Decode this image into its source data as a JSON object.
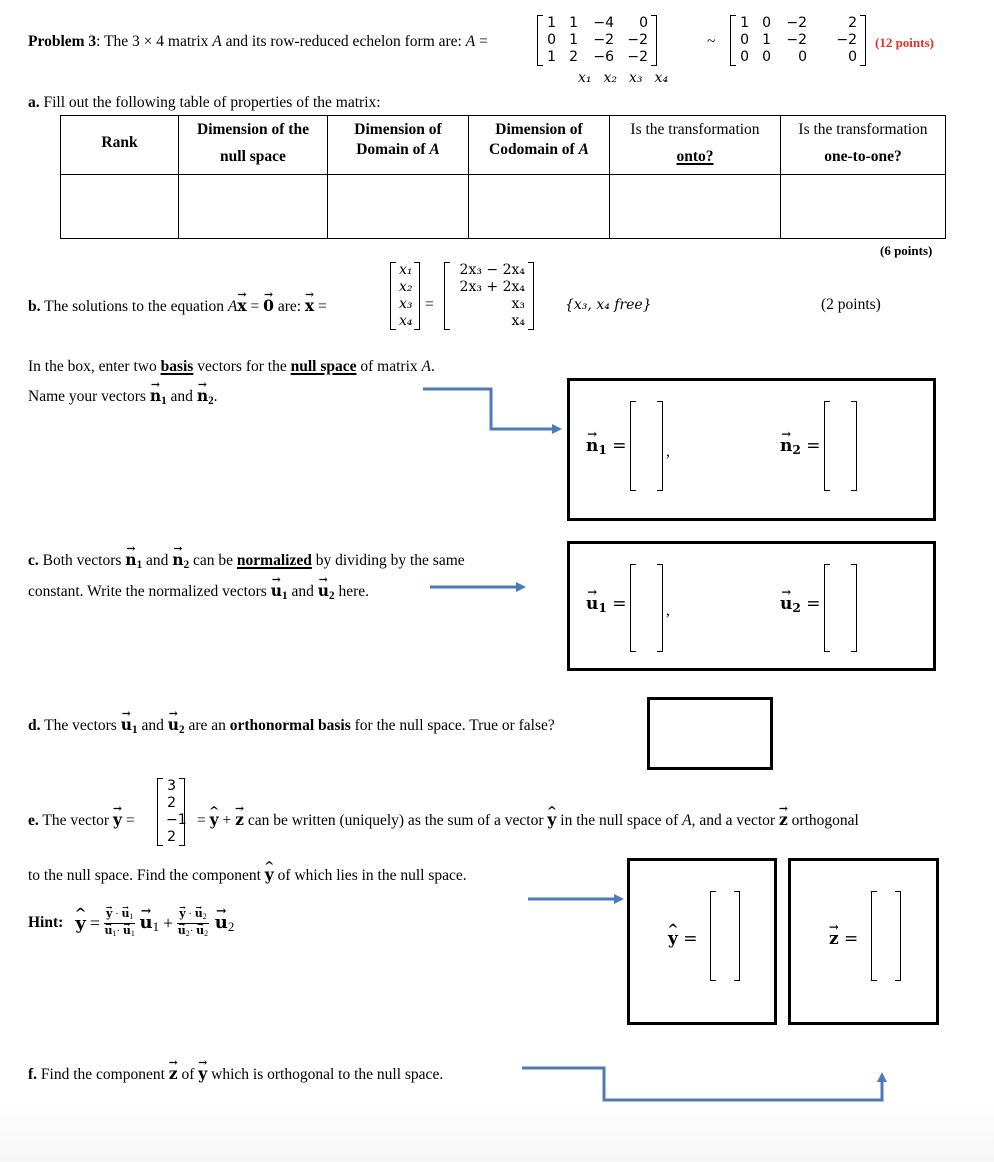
{
  "problem": {
    "title_bold": "Problem 3",
    "intro": ": The 3 × 4 matrix ",
    "matrix_name": "A",
    "intro_mid": " and its row-reduced echelon form are:  ",
    "matrix_A": [
      [
        "1",
        "1",
        "−4",
        "0"
      ],
      [
        "0",
        "1",
        "−2",
        "−2"
      ],
      [
        "1",
        "2",
        "−6",
        "−2"
      ]
    ],
    "column_labels": [
      "x₁",
      "x₂",
      "x₃",
      "x₄"
    ],
    "tilde": "~",
    "matrix_rref": [
      [
        "1",
        "0",
        "−2",
        "2"
      ],
      [
        "0",
        "1",
        "−2",
        "−2"
      ],
      [
        "0",
        "0",
        "0",
        "0"
      ]
    ],
    "points": "(12 points)",
    "points_color": "#e0302a"
  },
  "part_a": {
    "label": "a.",
    "text": " Fill out the following table of properties of the matrix:",
    "headers": [
      {
        "line1": "Rank",
        "line2": ""
      },
      {
        "line1": "Dimension of the",
        "line2": "null space"
      },
      {
        "line1": "Dimension of",
        "line2": "Domain of A"
      },
      {
        "line1": "Dimension of",
        "line2": "Codomain of A"
      },
      {
        "line1": "Is the transformation",
        "line2": "onto?"
      },
      {
        "line1": "Is the transformation",
        "line2": "one-to-one?"
      }
    ],
    "cells": [
      "",
      "",
      "",
      "",
      "",
      ""
    ],
    "points": "(6 points)"
  },
  "part_b": {
    "label": "b.",
    "text": " The solutions to the equation ",
    "equation": "Ax = 0",
    "are": " are: ",
    "x_vector": [
      "x₁",
      "x₂",
      "x₃",
      "x₄"
    ],
    "solution_vector": [
      "2x₃ − 2x₄",
      "2x₃ + 2x₄",
      "x₃",
      "x₄"
    ],
    "free_vars": "{x₃, x₄ free}",
    "points": "(2 points)",
    "instruction_line1_a": "In the box, enter two ",
    "instruction_basis": "basis",
    "instruction_line1_b": " vectors for the ",
    "instruction_null": "null space",
    "instruction_line1_c": " of matrix A.",
    "instruction_line2": "Name your vectors n₁ and n₂.",
    "answer_n1_label": "n₁ =",
    "answer_n2_label": "n₂ =",
    "answer_n1": "",
    "answer_n2": ""
  },
  "part_c": {
    "label": "c.",
    "line1_a": " Both vectors n₁ and n₂ can be ",
    "normalized": "normalized",
    "line1_b": " by dividing by the same",
    "line2": "constant. Write the normalized vectors u₁ and u₂ here.",
    "answer_u1_label": "u₁ =",
    "answer_u2_label": "u₂ =",
    "answer_u1": "",
    "answer_u2": ""
  },
  "part_d": {
    "label": "d.",
    "text_a": " The vectors u₁ and u₂ are an ",
    "bold": "orthonormal basis",
    "text_b": " for the null space. True or false?",
    "answer": ""
  },
  "part_e": {
    "label": "e.",
    "text_a": " The vector ",
    "y_vector": [
      "3",
      "2",
      "−1",
      "2"
    ],
    "text_b": " = ŷ + z can be written (uniquely) as the sum of a vector ŷ in the null space of A, and a vector z orthogonal",
    "line2": "to the null space. Find the component ŷ of which lies in the null space.",
    "hint_label": "Hint:",
    "hint_formula": "ŷ = (y·u₁)/(u₁·u₁) u₁ + (y·u₂)/(u₂·u₂) u₂",
    "answer_y_label": "ŷ =",
    "answer_z_label": "z =",
    "answer_y": "",
    "answer_z": ""
  },
  "part_f": {
    "label": "f.",
    "text": " Find the component z of y which is orthogonal to the null space."
  },
  "colors": {
    "arrow": "#4f7ab8"
  }
}
